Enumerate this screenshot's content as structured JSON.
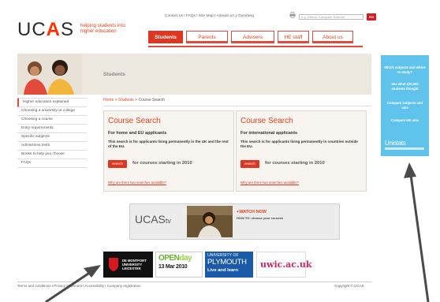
{
  "header": {
    "logo_text_before": "UC",
    "logo_text_accent": "A",
    "logo_text_after": "S",
    "tagline": "helping students into higher education",
    "top_links": "Contact us I FAQs I Site Map I Adsutio yn y Gymraeg",
    "search_placeholder": "e.g. Oxford, Computer Science",
    "search_go": "Go",
    "nav": [
      {
        "label": "Students",
        "active": true
      },
      {
        "label": "Parents",
        "active": false
      },
      {
        "label": "Advisers",
        "active": false
      },
      {
        "label": "HE staff",
        "active": false
      },
      {
        "label": "About us",
        "active": false
      }
    ]
  },
  "banner": {
    "section_title": "Students"
  },
  "promo": {
    "line1": "Which subjects and where to study?",
    "line2": "See what 220,000 students thought",
    "line3": "Compare subjects and unis",
    "line4": "Compare HE unis",
    "logo": "Unistats"
  },
  "sidebar": {
    "items": [
      "Higher education explained",
      "Choosing a university or college",
      "Choosing a course",
      "Entry requirements",
      "Specific subjects",
      "Admissions tests",
      "Books to help you choose",
      "FAQs"
    ]
  },
  "breadcrumb": {
    "home": "Home",
    "sep1": " > ",
    "students": "Students",
    "sep2": " > ",
    "current": "Course Search"
  },
  "course_search": [
    {
      "title": "Course Search",
      "subtitle": "For home and EU applicants",
      "description": "This search is for applicants living permanently in the UK and the rest of the EU.",
      "button": "search",
      "for_text": "for courses starting in 2010",
      "link": "Why are there two searches available?"
    },
    {
      "title": "Course Search",
      "subtitle": "For international applicants",
      "description": "This search is for applicants living permanently in countries outside the EU.",
      "button": "search",
      "for_text": "for courses starting in 2010",
      "link": "Why are there two searches available?"
    }
  ],
  "ucas_tv": {
    "logo": "UCAS",
    "logo_suffix": "tv",
    "watch": "+WATCH NOW",
    "howto": "HOW TO: choose your courses"
  },
  "sponsors": {
    "dmu": "DE MONTFORT UNIVERSITY LEICESTER",
    "openday_1": "OPEN",
    "openday_2": "day",
    "openday_date": "13 Mar 2010",
    "plymouth_1": "UNIVERSITY OF",
    "plymouth_2": "PLYMOUTH",
    "plymouth_3": "Live and learn",
    "uwic": "uwic.ac.uk"
  },
  "footer": {
    "left": "Terms and conditions I Privacy statement I Accessibility I Company registration",
    "right": "Copyright © UCAS"
  },
  "colors": {
    "brand_red": "#e03520",
    "promo_blue": "#5fc3eb",
    "arrow": "#4a4a4a"
  }
}
